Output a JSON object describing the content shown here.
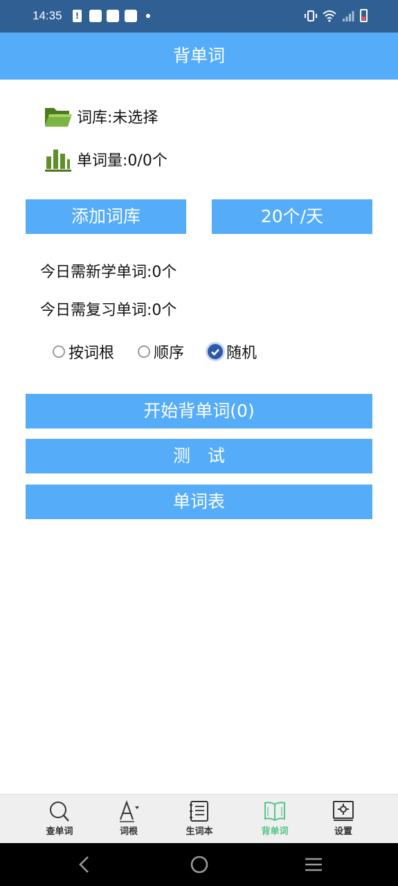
{
  "status_bar": {
    "time": "14:35"
  },
  "header": {
    "title": "背单词"
  },
  "library": {
    "label": "词库:未选择",
    "word_count_label": "单词量:0/0个"
  },
  "buttons": {
    "add_library": "添加词库",
    "per_day": "20个/天",
    "start": "开始背单词(0)",
    "test": "测　试",
    "word_list": "单词表"
  },
  "today": {
    "new_words": "今日需新学单词:0个",
    "review_words": "今日需复习单词:0个"
  },
  "order_options": [
    {
      "label": "按词根",
      "checked": false
    },
    {
      "label": "顺序",
      "checked": false
    },
    {
      "label": "随机",
      "checked": true
    }
  ],
  "bottom_nav": [
    {
      "label": "查单词",
      "icon": "search-icon"
    },
    {
      "label": "词根",
      "icon": "font-icon"
    },
    {
      "label": "生词本",
      "icon": "notebook-icon"
    },
    {
      "label": "背单词",
      "icon": "book-icon",
      "active": true
    },
    {
      "label": "设置",
      "icon": "settings-icon"
    }
  ],
  "colors": {
    "status_bar": "#2f5f93",
    "primary": "#55acf8",
    "active_tab": "#53c48a",
    "radio_checked": "#2c5aa8"
  }
}
